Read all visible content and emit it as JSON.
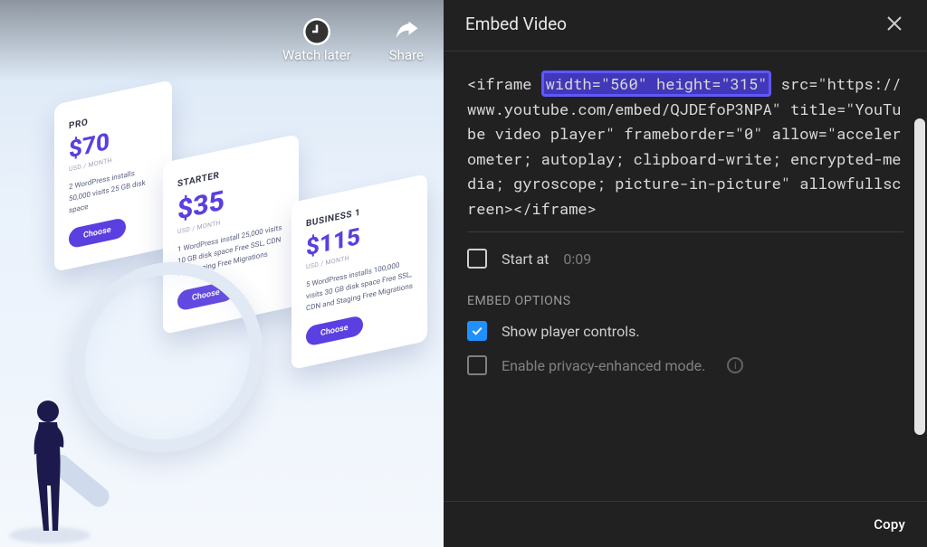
{
  "video_overlay": {
    "watch_later": "Watch later",
    "share": "Share"
  },
  "pricing": {
    "cards": [
      {
        "tier": "PRO",
        "price": "$70",
        "sub": "USD / MONTH",
        "features": "2 WordPress installs\n50,000 visits\n25 GB disk space",
        "cta": "Choose"
      },
      {
        "tier": "STARTER",
        "price": "$35",
        "sub": "USD / MONTH",
        "features": "1 WordPress install\n25,000 visits\n10 GB disk space\nFree SSL, CDN and Staging\nFree Migrations",
        "cta": "Choose"
      },
      {
        "tier": "BUSINESS 1",
        "price": "$115",
        "sub": "USD / MONTH",
        "features": "5 WordPress installs\n100,000 visits\n30 GB disk space\nFree SSL, CDN and Staging\nFree Migrations",
        "cta": "Choose"
      }
    ]
  },
  "panel": {
    "title": "Embed Video",
    "code_prefix": "<iframe ",
    "code_hl": "width=\"560\" height=\"315\"",
    "code_suffix": " src=\"https://www.youtube.com/embed/QJDEfoP3NPA\" title=\"YouTube video player\" frameborder=\"0\" allow=\"accelerometer; autoplay; clipboard-write; encrypted-media; gyroscope; picture-in-picture\" allowfullscreen></iframe>",
    "start_at_label": "Start at",
    "start_at_value": "0:09",
    "section_label": "EMBED OPTIONS",
    "opt_controls": "Show player controls.",
    "opt_privacy": "Enable privacy-enhanced mode.",
    "copy": "Copy"
  }
}
